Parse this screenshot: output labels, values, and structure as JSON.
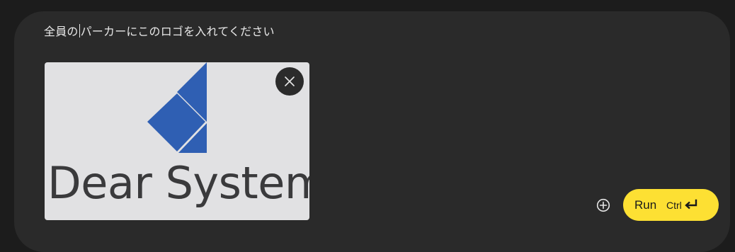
{
  "prompt": {
    "text_before_caret": "全員の",
    "text_after_caret": "パーカーにこのロゴを入れてください"
  },
  "attachment": {
    "logo_text": "Dear System",
    "logo_color": "#2f5fb3",
    "remove_icon": "close-icon"
  },
  "toolbar": {
    "add_icon": "add-circle-icon",
    "run_label": "Run",
    "shortcut_label": "Ctrl",
    "shortcut_icon": "enter-icon",
    "accent_color": "#fde033"
  }
}
